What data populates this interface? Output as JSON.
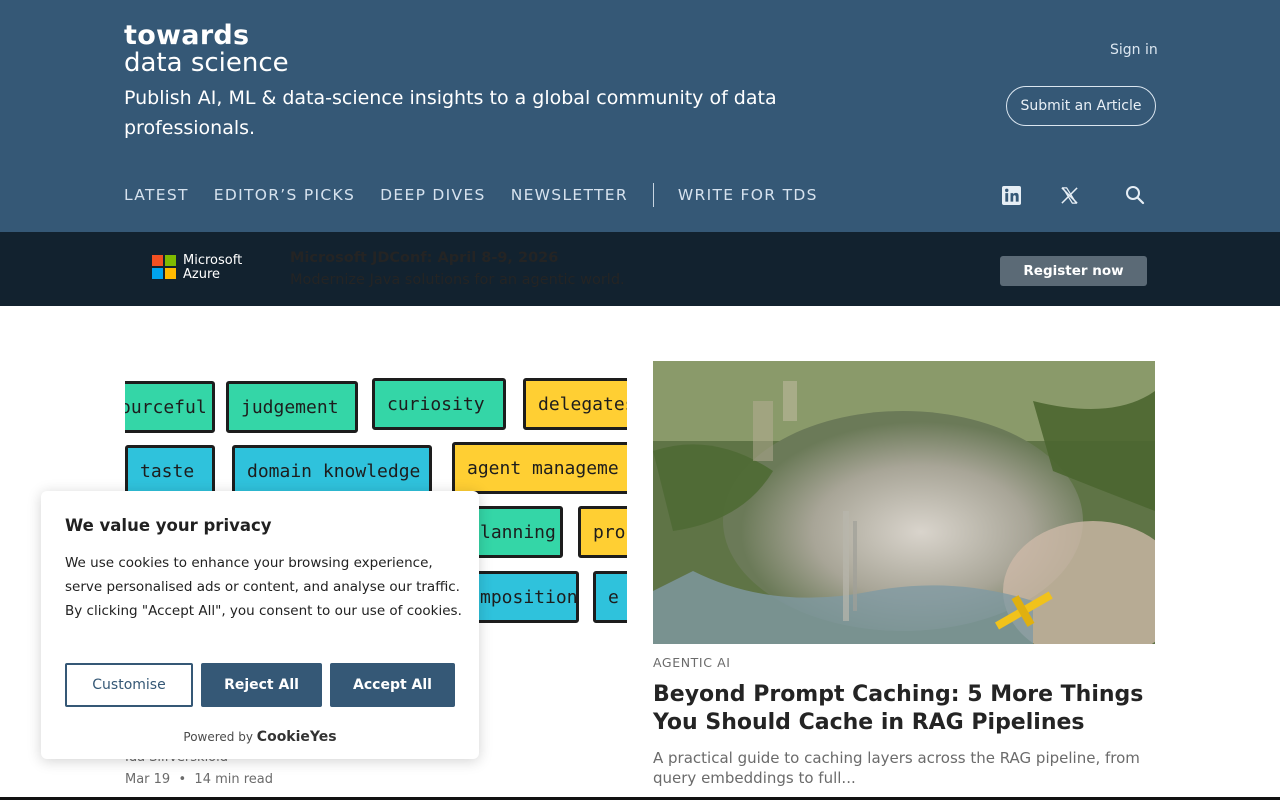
{
  "header": {
    "logo_line1": "towards",
    "logo_line2": "data science",
    "tagline": "Publish AI, ML & data-science insights to a global community of data professionals.",
    "sign_in": "Sign in",
    "submit_article": "Submit an Article",
    "nav": [
      "LATEST",
      "EDITOR’S PICKS",
      "DEEP DIVES",
      "NEWSLETTER",
      "WRITE FOR TDS"
    ],
    "social_icons": [
      "linkedin-icon",
      "x-icon",
      "search-icon"
    ]
  },
  "banner": {
    "brand_line1": "Microsoft",
    "brand_line2": "Azure",
    "title": "Microsoft JDConf: April 8-9, 2026",
    "subtitle": "Modernize Java solutions for an agentic world.",
    "cta": "Register now",
    "logo_colors": [
      "#f25022",
      "#7fba00",
      "#00a4ef",
      "#ffb900"
    ]
  },
  "left_article": {
    "tags": [
      "ourceful",
      "judgement",
      "curiosity",
      "delegates",
      "taste",
      "domain knowledge",
      "agent manageme",
      "lanning",
      "pro",
      "mposition",
      "e"
    ],
    "author": "Ida Silfverskiöld",
    "date": "Mar 19",
    "read_time": "14 min read"
  },
  "right_article": {
    "category": "AGENTIC AI",
    "title": "Beyond Prompt Caching: 5 More Things You Should Cache in RAG Pipelines",
    "excerpt": "A practical guide to caching layers across the RAG pipeline, from query embeddings to full..."
  },
  "cookie": {
    "title": "We value your privacy",
    "text": "We use cookies to enhance your browsing experience, serve personalised ads or content, and analyse our traffic. By clicking \"Accept All\", you consent to our use of cookies.",
    "customise": "Customise",
    "reject": "Reject All",
    "accept": "Accept All",
    "powered_by": "Powered by",
    "powered_brand": "CookieYes"
  },
  "colors": {
    "header_bg": "#355876",
    "banner_bg": "#12222f",
    "button_blue": "#355876"
  }
}
